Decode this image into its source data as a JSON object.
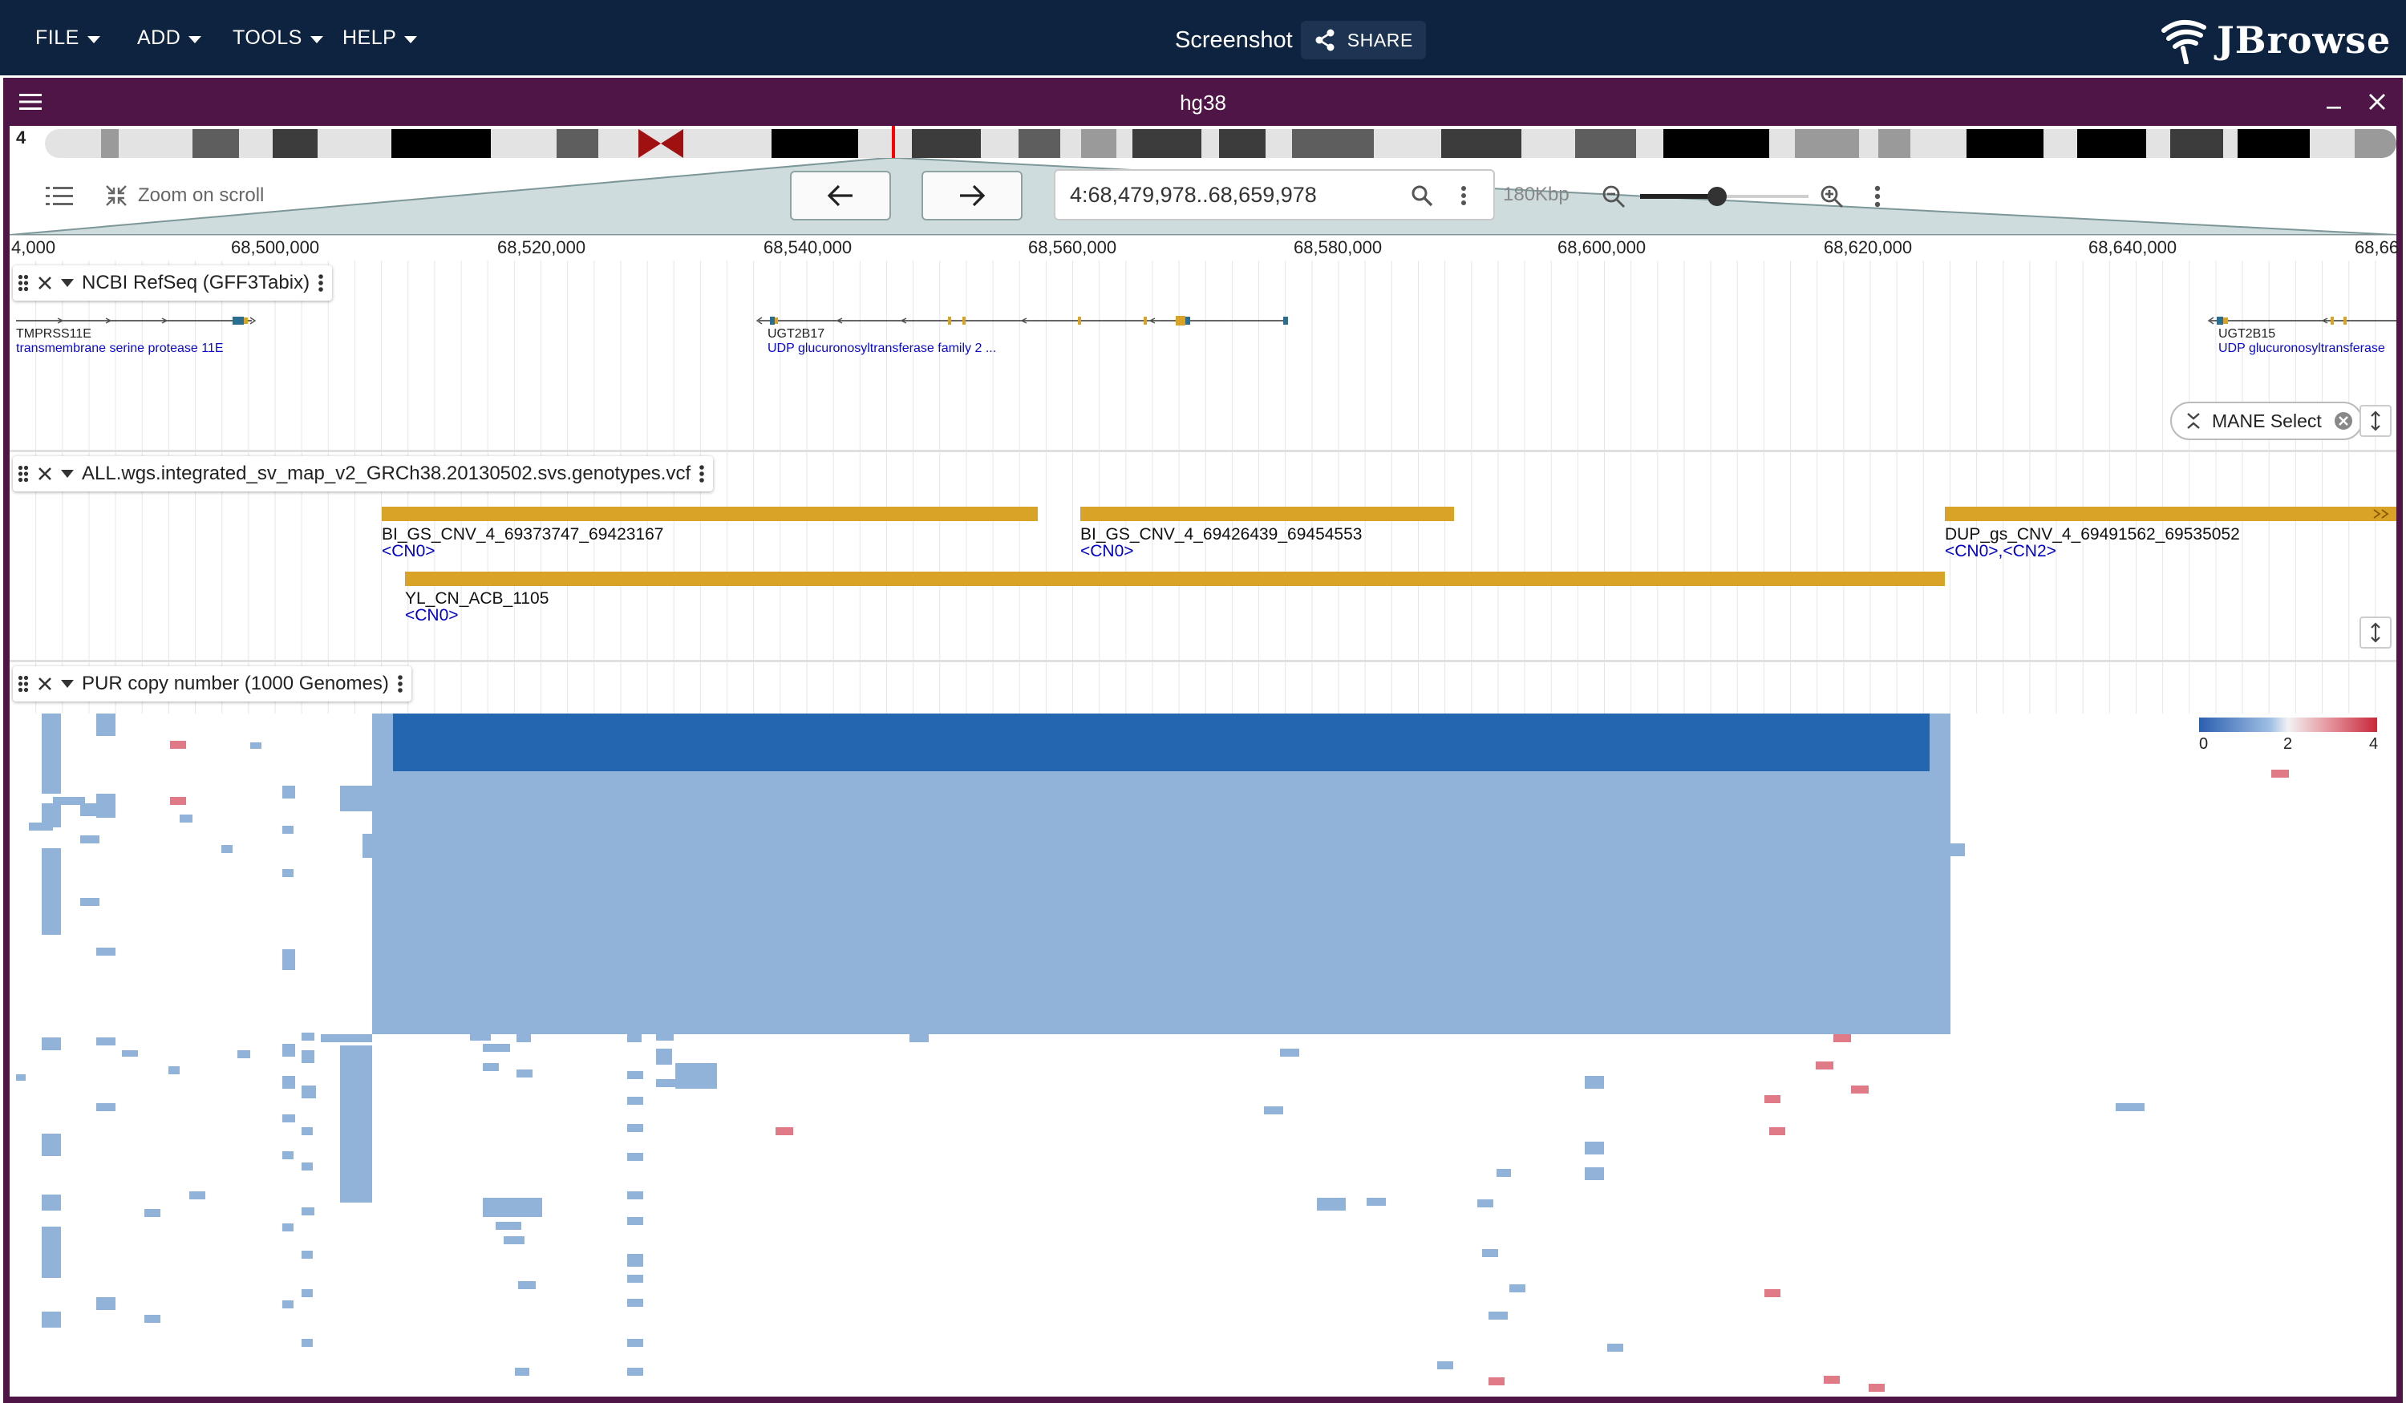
{
  "app": {
    "menus": [
      "FILE",
      "ADD",
      "TOOLS",
      "HELP"
    ],
    "title": "Screenshot",
    "share_label": "SHARE",
    "logo_text": "JBrowse",
    "accent_color": "#0d233f"
  },
  "view": {
    "assembly": "hg38",
    "chromosome": "4",
    "frame_color": "#4e1546"
  },
  "nav": {
    "zoom_on_scroll": "Zoom on scroll",
    "location": "4:68,479,978..68,659,978",
    "bp_size": "180Kbp",
    "zoom_level_fraction": 0.41
  },
  "scale": {
    "ticks": [
      "4,000",
      "68,500,000",
      "68,520,000",
      "68,540,000",
      "68,560,000",
      "68,580,000",
      "68,600,000",
      "68,620,000",
      "68,640,000",
      "68,66"
    ]
  },
  "tracks": [
    {
      "name": "NCBI RefSeq (GFF3Tabix)",
      "chip": "MANE Select",
      "features": [
        {
          "name": "TMPRSS11E",
          "desc": "transmembrane serine protease 11E"
        },
        {
          "name": "UGT2B17",
          "desc": "UDP glucuronosyltransferase family 2 ..."
        },
        {
          "name": "UGT2B15",
          "desc": "UDP glucuronosyltransferase"
        }
      ]
    },
    {
      "name": "ALL.wgs.integrated_sv_map_v2_GRCh38.20130502.svs.genotypes.vcf",
      "variants": [
        {
          "name": "BI_GS_CNV_4_69373747_69423167",
          "alt": "<CN0>"
        },
        {
          "name": "BI_GS_CNV_4_69426439_69454553",
          "alt": "<CN0>"
        },
        {
          "name": "DUP_gs_CNV_4_69491562_69535052",
          "alt": "<CN0>,<CN2>"
        },
        {
          "name": "YL_CN_ACB_1105",
          "alt": "<CN0>"
        }
      ]
    },
    {
      "name": "PUR copy number (1000 Genomes)",
      "legend": {
        "min": "0",
        "mid": "2",
        "max": "4"
      },
      "colors": {
        "cn0": "#2566b0",
        "cn1": "#91b3d9",
        "cn3": "#e07a86"
      }
    }
  ]
}
